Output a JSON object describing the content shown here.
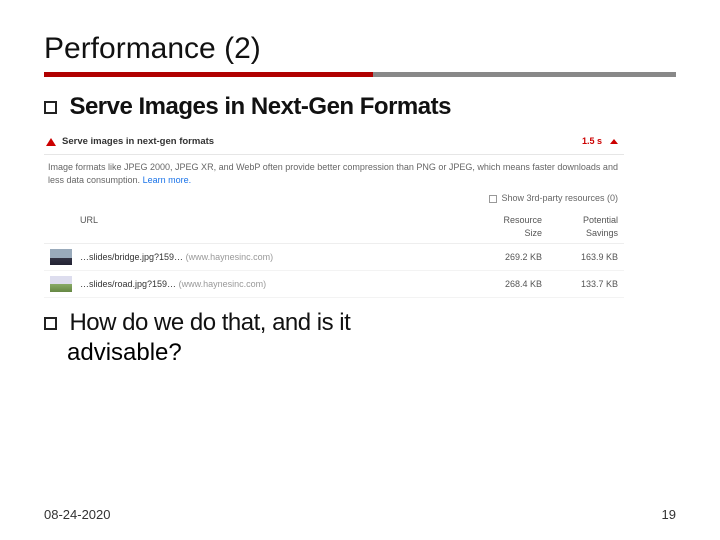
{
  "slide": {
    "title": "Performance (2)",
    "bullet1": "Serve Images in Next-Gen Formats",
    "bullet2_line1": "How do we do that, and is it",
    "bullet2_line2": "advisable?"
  },
  "audit": {
    "heading": "Serve images in next-gen formats",
    "timing": "1.5 s",
    "description": "Image formats like JPEG 2000, JPEG XR, and WebP often provide better compression than PNG or JPEG, which means faster downloads and less data consumption.",
    "learn_more": "Learn more.",
    "third_party_label": "Show 3rd-party resources (0)",
    "columns": {
      "url": "URL",
      "size": "Resource Size",
      "savings": "Potential Savings"
    },
    "rows": [
      {
        "path": "…slides/bridge.jpg?159…",
        "host": "(www.haynesinc.com)",
        "size": "269.2 KB",
        "savings": "163.9 KB"
      },
      {
        "path": "…slides/road.jpg?159…",
        "host": "(www.haynesinc.com)",
        "size": "268.4 KB",
        "savings": "133.7 KB"
      }
    ]
  },
  "footer": {
    "date": "08-24-2020",
    "page": "19"
  }
}
